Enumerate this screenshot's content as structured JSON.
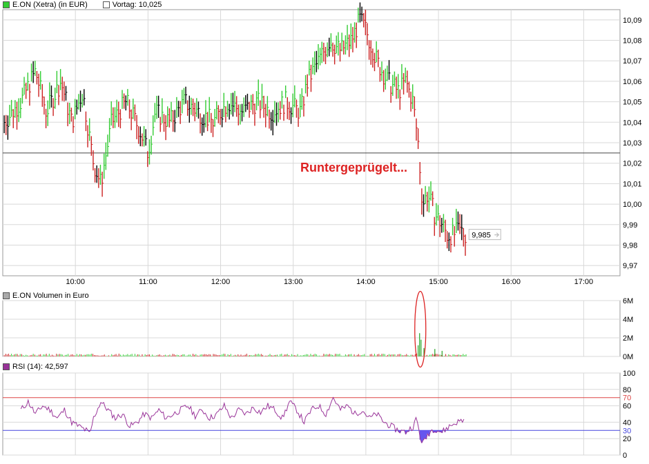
{
  "colors": {
    "up": "#33cc33",
    "down": "#cc2222",
    "flat": "#000000",
    "volume": "#33aa33",
    "rsi": "#993399",
    "rsi_upper": "#dd4444",
    "rsi_lower": "#4444dd",
    "rsi_fill": "#6655ee",
    "annotation": "#dd2222",
    "grid": "#d8d8d8",
    "prev_close": "#444444"
  },
  "price_panel": {
    "legend_instrument": "E.ON (Xetra) (in EUR)",
    "legend_prev": "Vortag: 10,025",
    "last_value_label": "9,985",
    "annotation": "Runtergeprügelt..."
  },
  "volume_panel": {
    "legend": "E.ON Volumen in Euro"
  },
  "rsi_panel": {
    "legend": "RSI (14): 42,597"
  },
  "chart_data": [
    {
      "type": "line",
      "title": "E.ON (Xetra) (in EUR)",
      "x_ticks": [
        "10:00",
        "11:00",
        "12:00",
        "13:00",
        "14:00",
        "15:00",
        "16:00",
        "17:00"
      ],
      "y_ticks": [
        "10,09",
        "10,08",
        "10,07",
        "10,06",
        "10,05",
        "10,04",
        "10,03",
        "10,02",
        "10,01",
        "10,00",
        "9,99",
        "9,98",
        "9,97"
      ],
      "ylim": [
        9.965,
        10.095
      ],
      "xlim_hours": [
        9.0,
        17.5
      ],
      "prev_close": 10.025,
      "last": 9.985,
      "series": [
        {
          "x": [
            9.02,
            9.25,
            9.45,
            9.6,
            9.8,
            9.95,
            10.1,
            10.25,
            10.35,
            10.5,
            10.7,
            10.9,
            11.0,
            11.1,
            11.3,
            11.5,
            11.7,
            11.9,
            12.1,
            12.3,
            12.5,
            12.7,
            12.9,
            13.1,
            13.2,
            13.35,
            13.5,
            13.65,
            13.8,
            13.92,
            14.0,
            14.15,
            14.3,
            14.45,
            14.55,
            14.65,
            14.72,
            14.78,
            14.85,
            14.95,
            15.05,
            15.12,
            15.2,
            15.3,
            15.38
          ],
          "y": [
            10.04,
            10.05,
            10.065,
            10.045,
            10.06,
            10.04,
            10.055,
            10.02,
            10.01,
            10.04,
            10.05,
            10.035,
            10.025,
            10.045,
            10.04,
            10.05,
            10.045,
            10.04,
            10.05,
            10.045,
            10.05,
            10.045,
            10.05,
            10.045,
            10.06,
            10.07,
            10.08,
            10.075,
            10.08,
            10.09,
            10.085,
            10.07,
            10.06,
            10.055,
            10.06,
            10.05,
            10.03,
            10.0,
            10.005,
            9.995,
            9.99,
            9.985,
            9.985,
            9.987,
            9.985
          ]
        }
      ]
    },
    {
      "type": "bar",
      "title": "E.ON Volumen in Euro",
      "y_ticks": [
        "6M",
        "4M",
        "2M",
        "0M"
      ],
      "ylim": [
        0,
        6
      ],
      "spike": {
        "x": 14.75,
        "value": 2.5
      }
    },
    {
      "type": "line",
      "title": "RSI (14): 42,597",
      "y_ticks": [
        "100",
        "80",
        "70",
        "60",
        "40",
        "30",
        "20",
        "0"
      ],
      "ylim": [
        0,
        100
      ],
      "levels": [
        70,
        30
      ],
      "x": [
        9.25,
        9.35,
        9.45,
        9.55,
        9.65,
        9.75,
        9.85,
        9.95,
        10.05,
        10.15,
        10.2,
        10.25,
        10.35,
        10.45,
        10.55,
        10.65,
        10.75,
        10.85,
        10.95,
        11.05,
        11.15,
        11.25,
        11.35,
        11.45,
        11.55,
        11.65,
        11.75,
        11.85,
        11.95,
        12.05,
        12.15,
        12.25,
        12.35,
        12.45,
        12.55,
        12.65,
        12.75,
        12.85,
        12.95,
        13.05,
        13.15,
        13.25,
        13.35,
        13.45,
        13.55,
        13.65,
        13.75,
        13.85,
        13.95,
        14.05,
        14.15,
        14.25,
        14.35,
        14.45,
        14.55,
        14.65,
        14.7,
        14.75,
        14.8,
        14.85,
        14.9,
        14.95,
        15.05,
        15.15,
        15.25,
        15.35
      ],
      "y": [
        55,
        65,
        50,
        60,
        55,
        45,
        55,
        40,
        35,
        30,
        25,
        45,
        65,
        55,
        45,
        50,
        35,
        40,
        50,
        45,
        55,
        45,
        50,
        55,
        60,
        48,
        55,
        45,
        50,
        60,
        45,
        55,
        50,
        58,
        52,
        60,
        55,
        45,
        65,
        55,
        40,
        55,
        60,
        50,
        70,
        55,
        60,
        50,
        55,
        45,
        50,
        40,
        35,
        30,
        28,
        35,
        45,
        20,
        15,
        25,
        30,
        32,
        28,
        35,
        40,
        43
      ]
    }
  ]
}
